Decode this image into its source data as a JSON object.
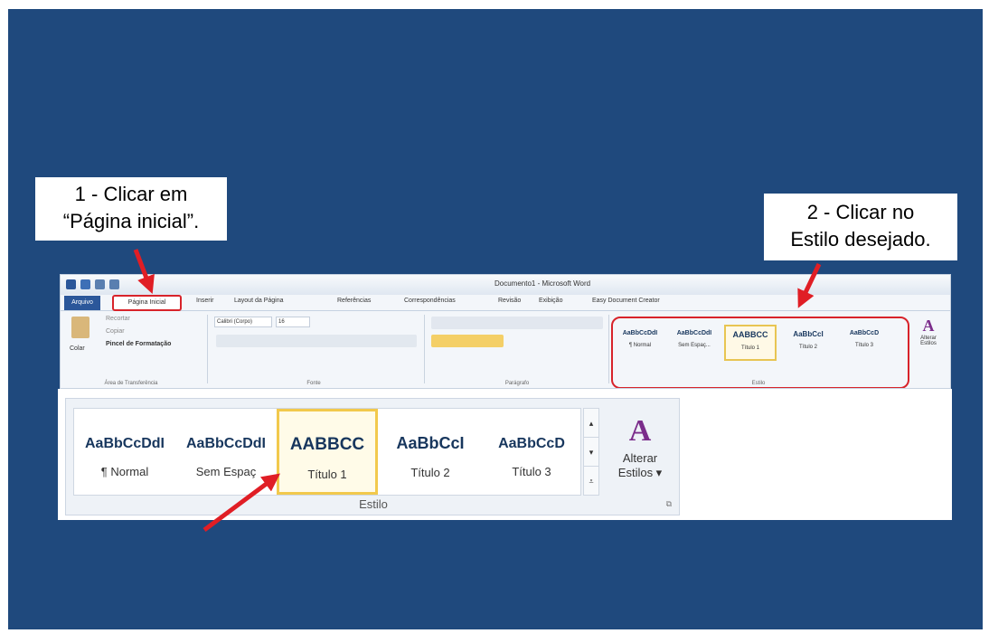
{
  "callouts": {
    "step1_line1": "1 - Clicar em",
    "step1_line2": "“Página inicial”.",
    "step2_line1": "2 - Clicar no",
    "step2_line2": "Estilo desejado."
  },
  "ribbon": {
    "window_title": "Documento1 - Microsoft Word",
    "tabs": [
      "Arquivo",
      "Página Inicial",
      "Inserir",
      "Layout da Página",
      "Referências",
      "Correspondências",
      "Revisão",
      "Exibição",
      "Easy Document Creator"
    ],
    "clipboard": {
      "paste_label": "Colar",
      "cut_label": "Recortar",
      "copy_label": "Copiar",
      "format_painter_label": "Pincel de Formatação",
      "group_label": "Área de Transferência"
    },
    "font": {
      "font_name": "Calibri (Corpo)",
      "font_size": "16",
      "group_label": "Fonte"
    },
    "paragraph": {
      "group_label": "Parágrafo"
    },
    "styles": {
      "items": [
        {
          "sample": "AaBbCcDdI",
          "label": "¶ Normal"
        },
        {
          "sample": "AaBbCcDdI",
          "label": "Sem Espaç..."
        },
        {
          "sample": "AABBCC",
          "label": "Título 1"
        },
        {
          "sample": "AaBbCcI",
          "label": "Título 2"
        },
        {
          "sample": "AaBbCcD",
          "label": "Título 3"
        }
      ],
      "group_label": "Estilo",
      "change_styles_line1": "Alterar",
      "change_styles_line2": "Estilos"
    }
  },
  "zoom_gallery": {
    "items": [
      {
        "sample": "AaBbCcDdI",
        "label": "¶ Normal"
      },
      {
        "sample": "AaBbCcDdI",
        "label": "Sem Espaç"
      },
      {
        "sample": "AABBCC",
        "label": "Título 1"
      },
      {
        "sample": "AaBbCcI",
        "label": "Título 2"
      },
      {
        "sample": "AaBbCcD",
        "label": "Título 3"
      }
    ],
    "change_styles_line1": "Alterar",
    "change_styles_line2": "Estilos ▾",
    "group_label": "Estilo"
  },
  "colors": {
    "slide_background": "#1f497d",
    "highlight_red": "#d8232a",
    "arrow_red": "#e01e25",
    "selected_style_gold": "#f2c94c",
    "heading_text": "#17365d"
  }
}
